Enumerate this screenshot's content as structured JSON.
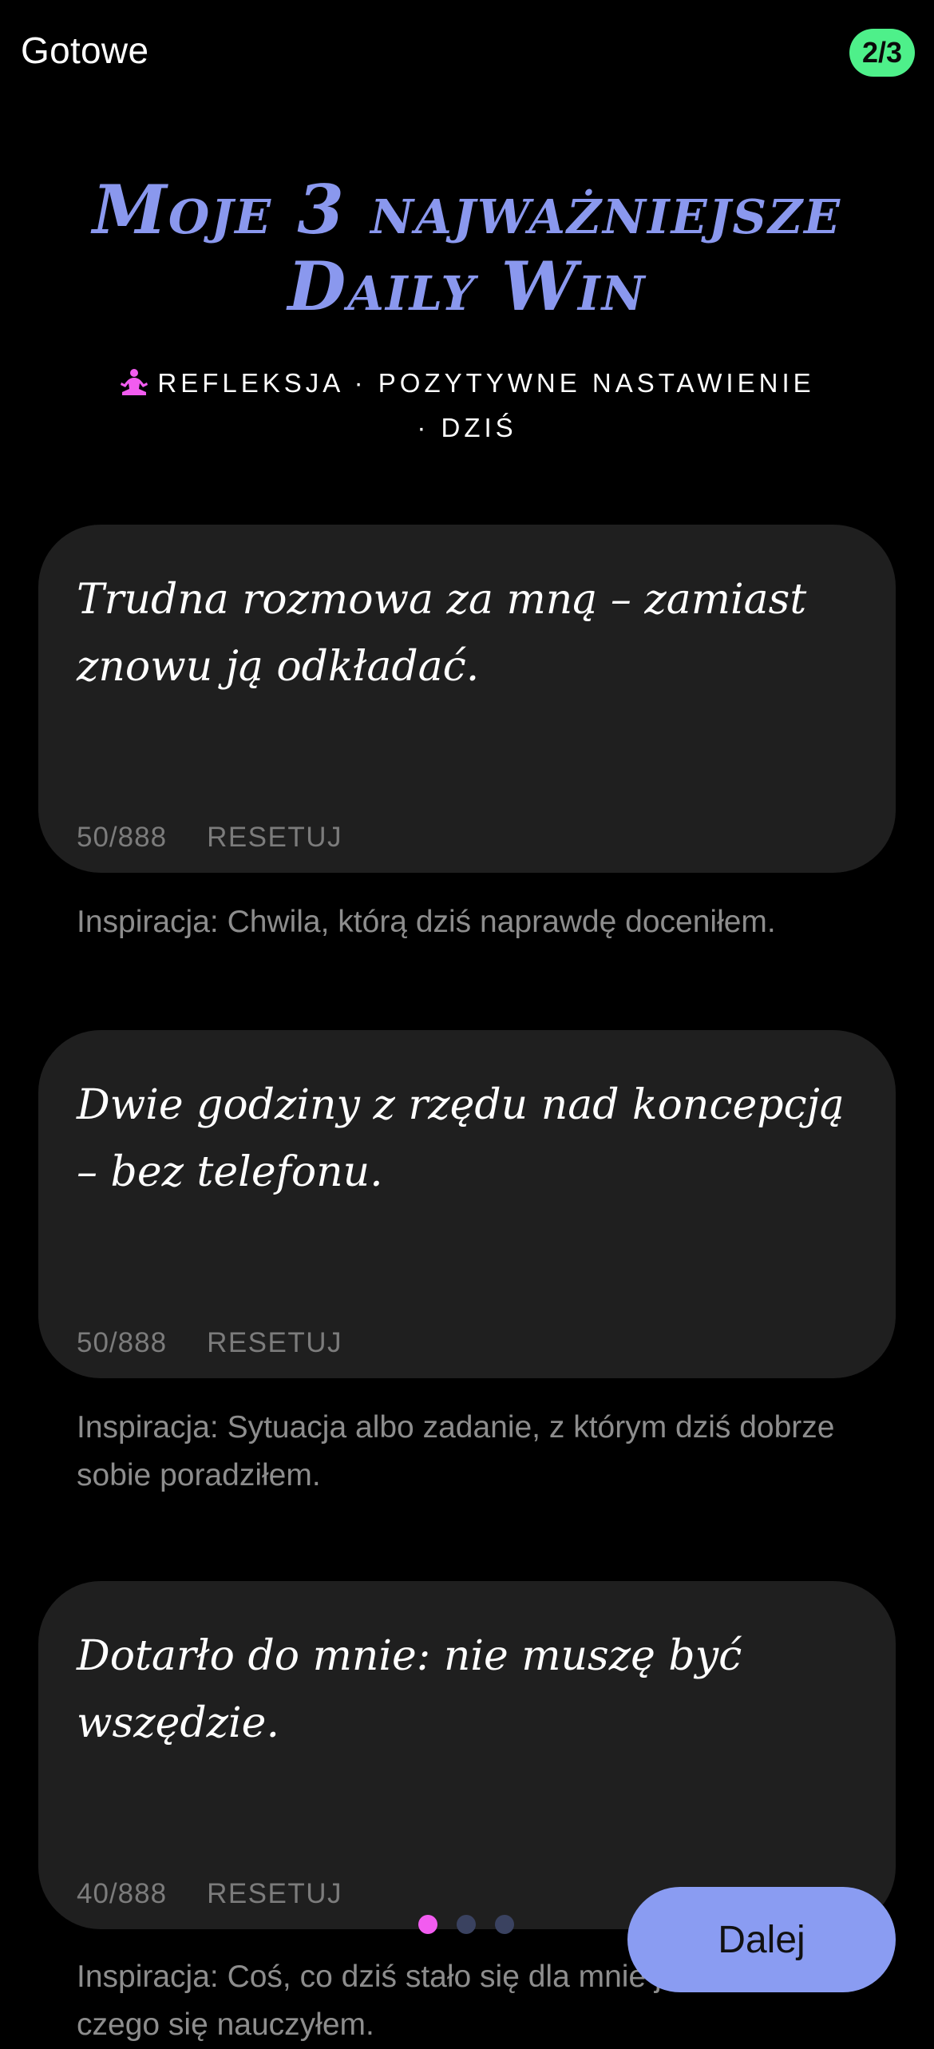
{
  "header": {
    "done_label": "Gotowe",
    "step_badge": "2/3"
  },
  "title": {
    "line1": "Moje 3 najważniejsze",
    "line2": "Daily Win"
  },
  "subtitle": {
    "icon": "meditation-icon",
    "icon_color": "#f25cf0",
    "text": "REFLEKSJA · POZYTYWNE NASTAWIENIE · DZIŚ"
  },
  "entries": [
    {
      "text": "Trudna rozmowa za mną – zamiast znowu ją odkładać.",
      "count": "50/888",
      "reset_label": "RESETUJ",
      "hint": "Inspiracja: Chwila, którą dziś naprawdę doceniłem."
    },
    {
      "text": "Dwie godziny z rzędu nad koncepcją – bez telefonu.",
      "count": "50/888",
      "reset_label": "RESETUJ",
      "hint": "Inspiracja: Sytuacja albo zadanie, z którym dziś dobrze sobie poradziłem."
    },
    {
      "text": "Dotarło do mnie: nie muszę być wszędzie.",
      "count": "40/888",
      "reset_label": "RESETUJ",
      "hint": "Inspiracja: Coś, co dziś stało się dla mnie jasne, albo czego się nauczyłem."
    }
  ],
  "pagination": {
    "total": 3,
    "active_index": 0
  },
  "next_button": {
    "label": "Dalej"
  },
  "colors": {
    "background": "#000000",
    "card": "#1f1f1f",
    "accent_title": "#8a98ee",
    "badge": "#4ef08a",
    "button": "#8a9cf2",
    "dot_active": "#f25cf0",
    "dot_inactive": "#3a4260"
  }
}
